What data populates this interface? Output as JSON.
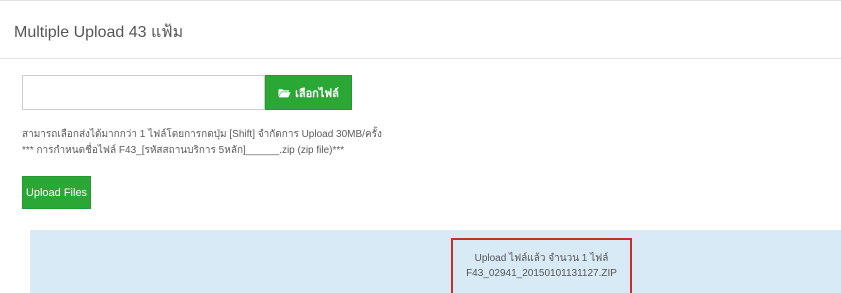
{
  "header": {
    "title": "Multiple Upload 43 แฟ้ม"
  },
  "file_picker": {
    "value": "",
    "button_label": "เลือกไฟล์",
    "button_icon": "folder-open-icon"
  },
  "help": {
    "line1": "สามารถเลือกส่งได้มากกว่า 1 ไฟล์โดยการกดปุ่ม [Shift] จำกัดการ Upload 30MB/ครั้ง",
    "line2": "*** การกำหนดชื่อไฟล์ F43_[รหัสสถานบริการ 5หลัก]______.zip (zip file)***"
  },
  "upload": {
    "button_label": "Upload Files"
  },
  "result": {
    "line1": "Upload ไฟล์แล้ว จำนวน 1 ไฟล์",
    "line2": "F43_02941_20150101131127.ZIP"
  },
  "colors": {
    "button_green": "#2aa735",
    "panel_blue": "#d8eaf6",
    "highlight_red": "#c4302b"
  }
}
